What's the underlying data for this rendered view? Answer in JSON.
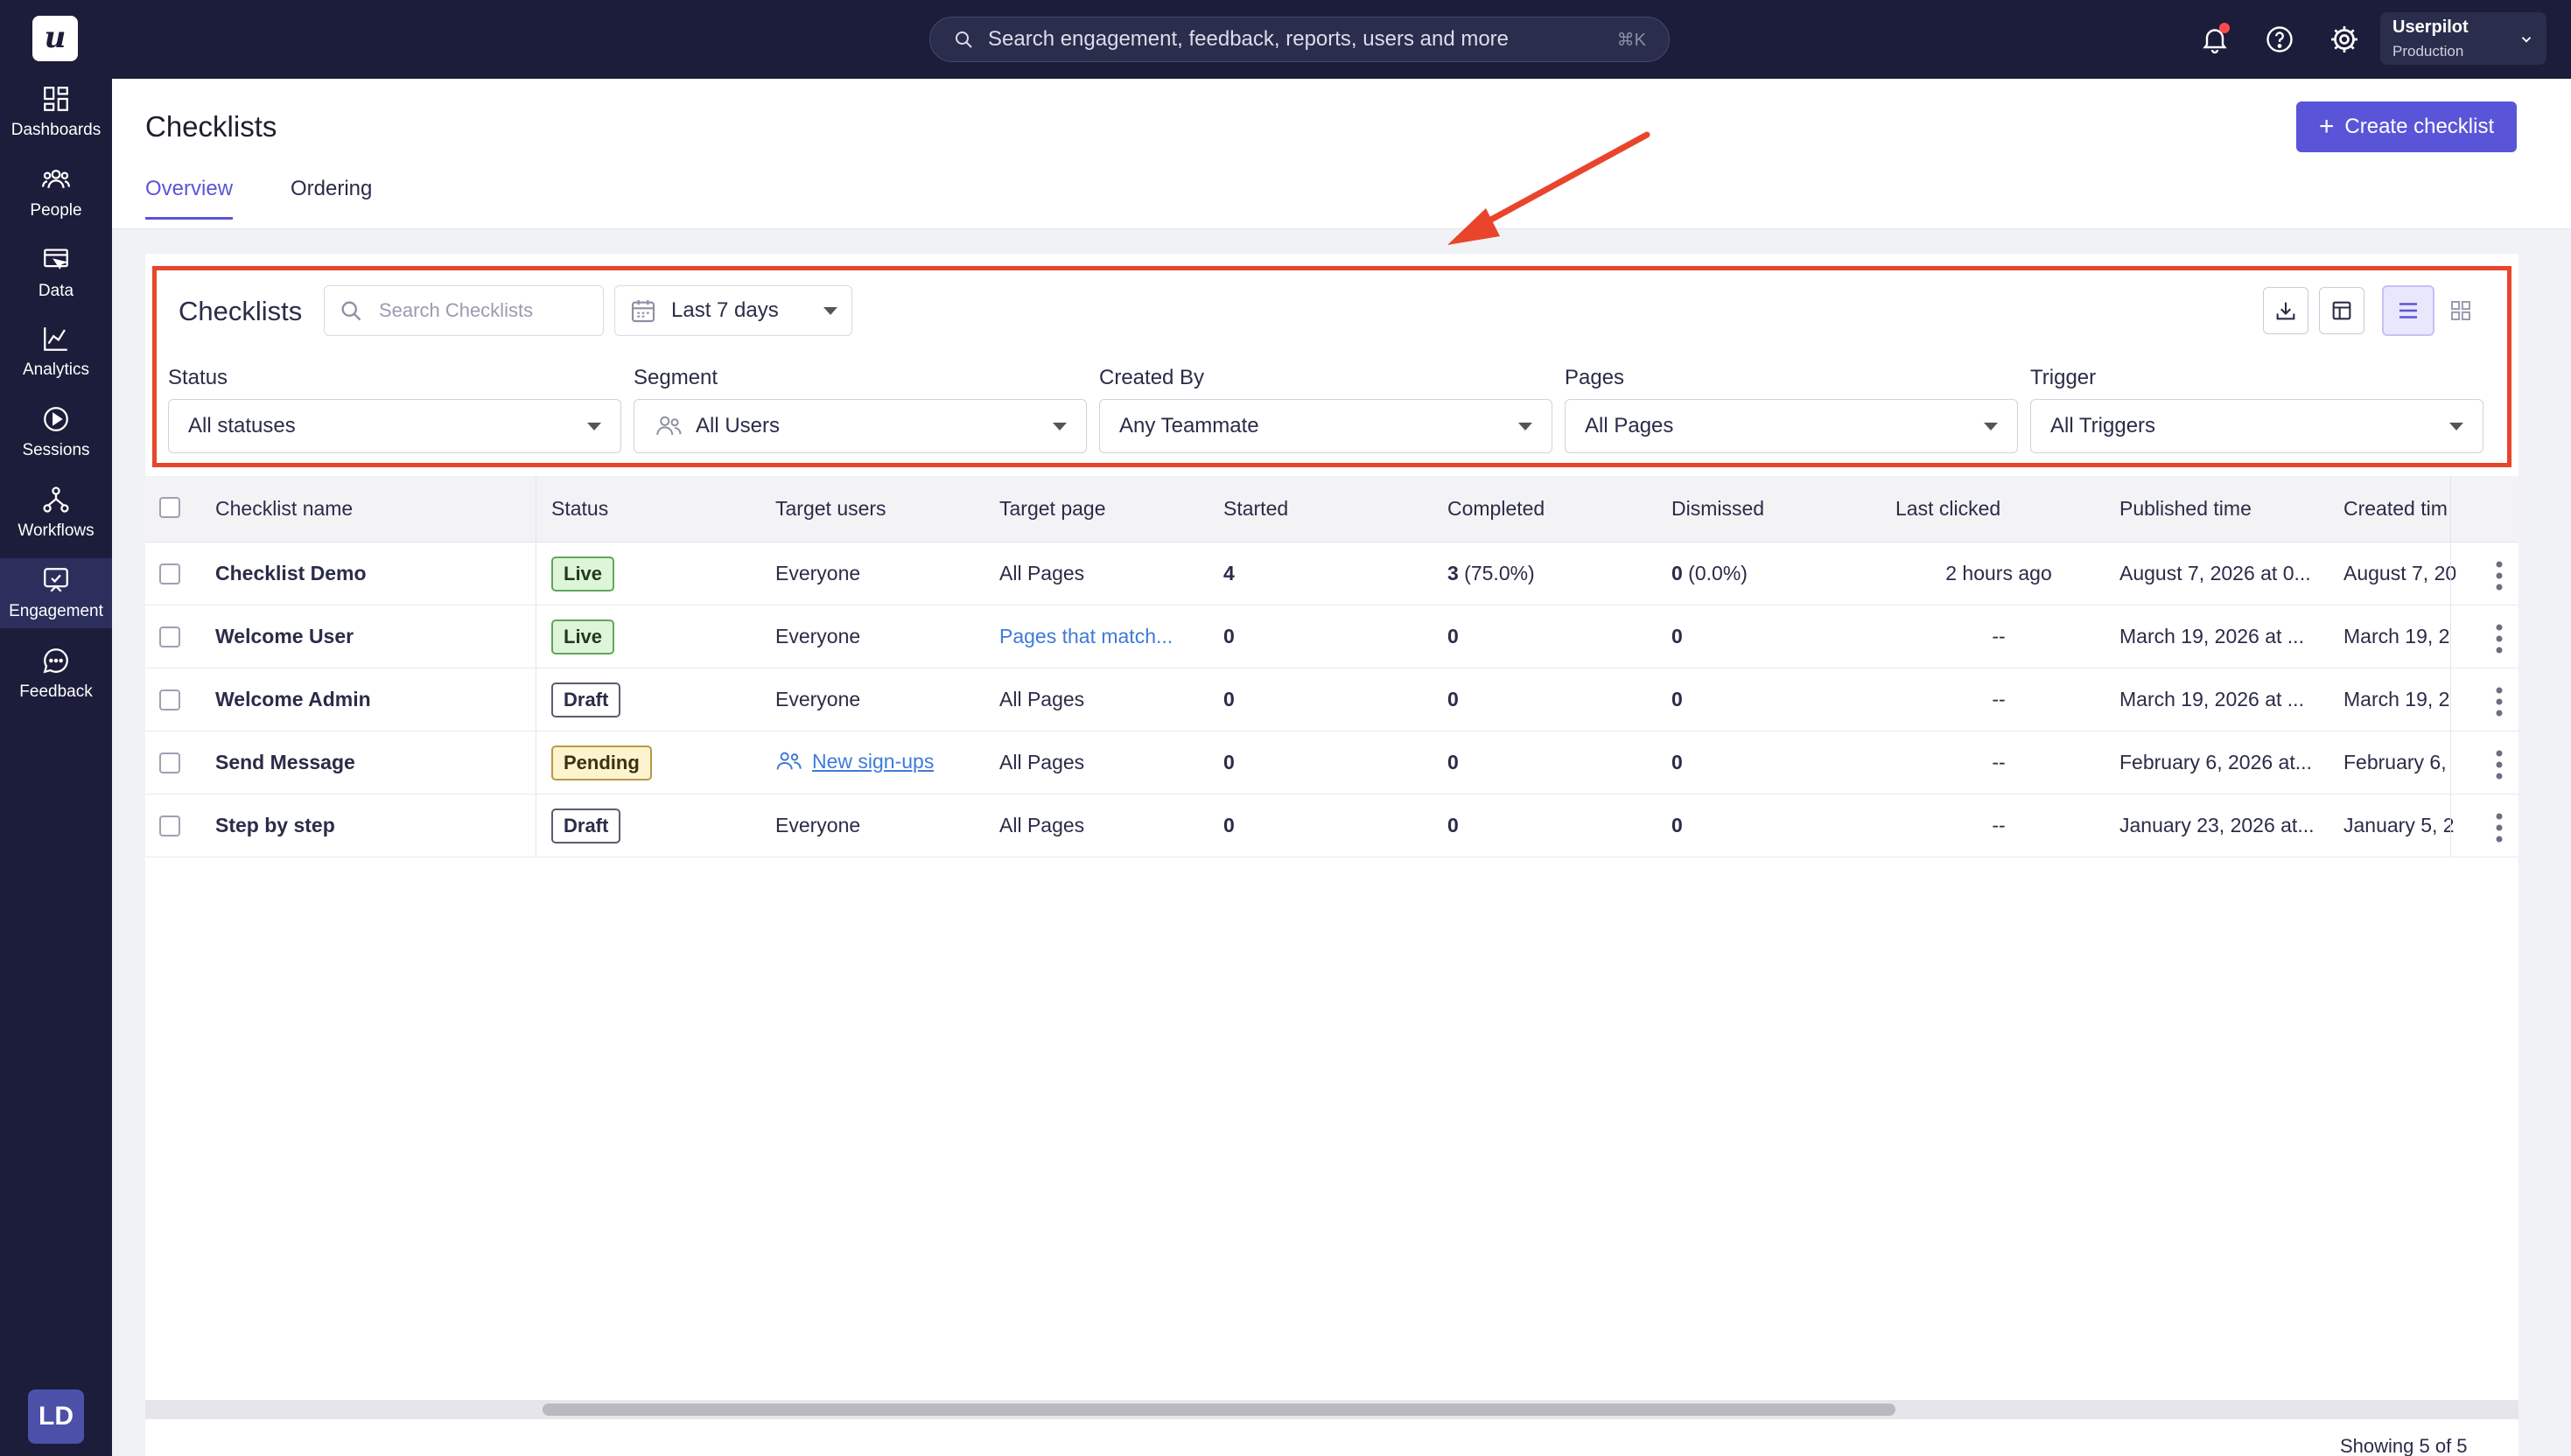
{
  "sidebar": {
    "logo": "u",
    "items": [
      {
        "label": "Dashboards",
        "icon": "dashboards-icon"
      },
      {
        "label": "People",
        "icon": "people-icon"
      },
      {
        "label": "Data",
        "icon": "data-icon"
      },
      {
        "label": "Analytics",
        "icon": "analytics-icon"
      },
      {
        "label": "Sessions",
        "icon": "sessions-icon"
      },
      {
        "label": "Workflows",
        "icon": "workflows-icon"
      },
      {
        "label": "Engagement",
        "icon": "engagement-icon"
      },
      {
        "label": "Feedback",
        "icon": "feedback-icon"
      }
    ],
    "active": "Engagement",
    "avatar": "LD"
  },
  "topbar": {
    "search_placeholder": "Search engagement, feedback, reports, users and more",
    "search_shortcut": "⌘K",
    "account_name": "Userpilot",
    "account_env": "Production"
  },
  "header": {
    "title": "Checklists",
    "create_button": "Create checklist",
    "tabs": [
      {
        "label": "Overview",
        "active": true
      },
      {
        "label": "Ordering",
        "active": false
      }
    ]
  },
  "filters": {
    "title": "Checklists",
    "search_placeholder": "Search Checklists",
    "date_range": "Last 7 days",
    "status": {
      "label": "Status",
      "value": "All statuses"
    },
    "segment": {
      "label": "Segment",
      "value": "All Users"
    },
    "created_by": {
      "label": "Created By",
      "value": "Any Teammate"
    },
    "pages": {
      "label": "Pages",
      "value": "All Pages"
    },
    "trigger": {
      "label": "Trigger",
      "value": "All Triggers"
    }
  },
  "table": {
    "columns": [
      "Checklist name",
      "Status",
      "Target users",
      "Target page",
      "Started",
      "Completed",
      "Dismissed",
      "Last clicked",
      "Published time",
      "Created tim"
    ],
    "rows": [
      {
        "name": "Checklist Demo",
        "status": "Live",
        "target_users": "Everyone",
        "target_page": "All Pages",
        "started": "4",
        "completed": "3",
        "completed_pct": " (75.0%)",
        "dismissed": "0",
        "dismissed_pct": " (0.0%)",
        "last_clicked": "2 hours ago",
        "published": "August 7, 2026 at 0...",
        "created": "August 7, 20"
      },
      {
        "name": "Welcome User",
        "status": "Live",
        "target_users": "Everyone",
        "target_page": "Pages that match...",
        "started": "0",
        "completed": "0",
        "completed_pct": "",
        "dismissed": "0",
        "dismissed_pct": "",
        "last_clicked": "--",
        "published": "March 19, 2026 at ...",
        "created": "March 19, 2"
      },
      {
        "name": "Welcome Admin",
        "status": "Draft",
        "target_users": "Everyone",
        "target_page": "All Pages",
        "started": "0",
        "completed": "0",
        "completed_pct": "",
        "dismissed": "0",
        "dismissed_pct": "",
        "last_clicked": "--",
        "published": "March 19, 2026 at ...",
        "created": "March 19, 2"
      },
      {
        "name": "Send Message",
        "status": "Pending",
        "target_users": "New sign-ups",
        "target_page": "All Pages",
        "started": "0",
        "completed": "0",
        "completed_pct": "",
        "dismissed": "0",
        "dismissed_pct": "",
        "last_clicked": "--",
        "published": "February 6, 2026 at...",
        "created": "February 6,"
      },
      {
        "name": "Step by step",
        "status": "Draft",
        "target_users": "Everyone",
        "target_page": "All Pages",
        "started": "0",
        "completed": "0",
        "completed_pct": "",
        "dismissed": "0",
        "dismissed_pct": "",
        "last_clicked": "--",
        "published": "January 23, 2026 at...",
        "created": "January 5, 2"
      }
    ],
    "footer": "Showing 5 of 5"
  },
  "colors": {
    "sidebar_bg": "#1c1d3a",
    "accent": "#5a55d8",
    "highlight_box": "#e8452c",
    "arrow": "#e8452c",
    "live_bg": "#dff5da",
    "pending_bg": "#fdf3cf"
  }
}
